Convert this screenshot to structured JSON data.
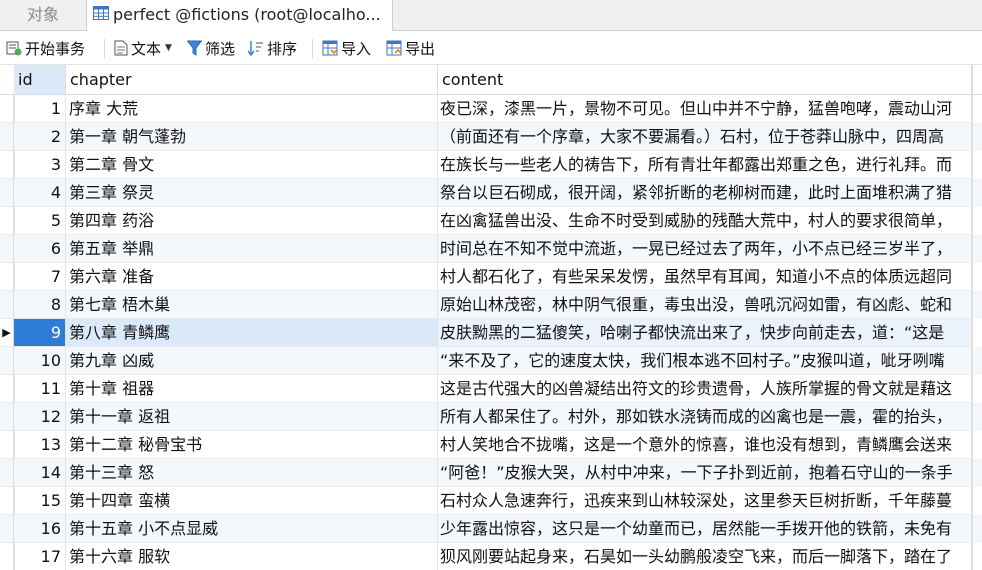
{
  "tabs": {
    "objects": "对象",
    "table": "perfect @fictions (root@localho..."
  },
  "toolbar": {
    "begin_transaction": "开始事务",
    "text": "文本",
    "filter": "筛选",
    "sort": "排序",
    "import": "导入",
    "export": "导出"
  },
  "grid": {
    "columns": {
      "id": "id",
      "chapter": "chapter",
      "content": "content"
    },
    "selected_row_index": 8,
    "rows": [
      {
        "id": "1",
        "chapter": "序章 大荒",
        "content": "夜已深，漆黑一片，景物不可见。但山中并不宁静，猛兽咆哮，震动山河"
      },
      {
        "id": "2",
        "chapter": "第一章 朝气蓬勃",
        "content": "（前面还有一个序章，大家不要漏看。）石村，位于苍莽山脉中，四周高"
      },
      {
        "id": "3",
        "chapter": "第二章 骨文",
        "content": "在族长与一些老人的祷告下，所有青壮年都露出郑重之色，进行礼拜。而"
      },
      {
        "id": "4",
        "chapter": "第三章 祭灵",
        "content": "祭台以巨石砌成，很开阔，紧邻折断的老柳树而建，此时上面堆积满了猎"
      },
      {
        "id": "5",
        "chapter": "第四章 药浴",
        "content": "在凶禽猛兽出没、生命不时受到威胁的残酷大荒中，村人的要求很简单，"
      },
      {
        "id": "6",
        "chapter": "第五章 举鼎",
        "content": "时间总在不知不觉中流逝，一晃已经过去了两年，小不点已经三岁半了，"
      },
      {
        "id": "7",
        "chapter": "第六章 准备",
        "content": "村人都石化了，有些呆呆发愣，虽然早有耳闻，知道小不点的体质远超同"
      },
      {
        "id": "8",
        "chapter": "第七章 梧木巢",
        "content": "原始山林茂密，林中阴气很重，毒虫出没，兽吼沉闷如雷，有凶彪、蛇和"
      },
      {
        "id": "9",
        "chapter": "第八章 青鳞鹰",
        "content": "皮肤黝黑的二猛傻笑，哈喇子都快流出来了，快步向前走去，道：“这是"
      },
      {
        "id": "10",
        "chapter": "第九章 凶威",
        "content": "“来不及了，它的速度太快，我们根本逃不回村子。”皮猴叫道，呲牙咧嘴"
      },
      {
        "id": "11",
        "chapter": "第十章 祖器",
        "content": "这是古代强大的凶兽凝结出符文的珍贵遗骨，人族所掌握的骨文就是藉这"
      },
      {
        "id": "12",
        "chapter": "第十一章 返祖",
        "content": "所有人都呆住了。村外，那如铁水浇铸而成的凶禽也是一震，霍的抬头，"
      },
      {
        "id": "13",
        "chapter": "第十二章 秘骨宝书",
        "content": "村人笑地合不拢嘴，这是一个意外的惊喜，谁也没有想到，青鳞鹰会送来"
      },
      {
        "id": "14",
        "chapter": "第十三章 怒",
        "content": "“阿爸！”皮猴大哭，从村中冲来，一下子扑到近前，抱着石守山的一条手"
      },
      {
        "id": "15",
        "chapter": "第十四章 蛮横",
        "content": "石村众人急速奔行，迅疾来到山林较深处，这里参天巨树折断，千年藤蔓"
      },
      {
        "id": "16",
        "chapter": "第十五章 小不点显威",
        "content": "少年露出惊容，这只是一个幼童而已，居然能一手拨开他的铁箭，未免有"
      },
      {
        "id": "17",
        "chapter": "第十六章 服软",
        "content": "狈风刚要站起身来，石昊如一头幼鹏般凌空飞来，而后一脚落下，踏在了"
      }
    ]
  },
  "colors": {
    "selection_accent": "#2f7cd6",
    "selected_row": "#dbe9f8",
    "alt_row": "#f4f7fc"
  }
}
